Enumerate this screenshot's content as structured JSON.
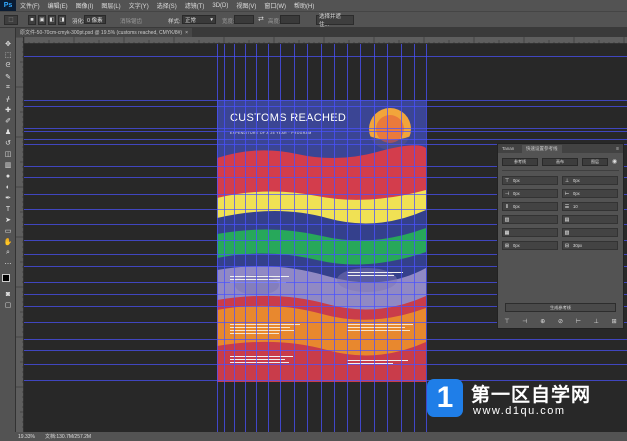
{
  "app": {
    "logo": "Ps"
  },
  "menu": [
    "文件(F)",
    "编辑(E)",
    "图像(I)",
    "图层(L)",
    "文字(Y)",
    "选择(S)",
    "滤镜(T)",
    "3D(D)",
    "视图(V)",
    "窗口(W)",
    "帮助(H)"
  ],
  "options": {
    "feather_label": "羽化:",
    "feather_value": "0 像素",
    "antialias_label": "消除锯齿",
    "style_label": "样式:",
    "style_value": "正常",
    "width_label": "宽度:",
    "height_label": "高度:",
    "select_mask_label": "选择并遮住..."
  },
  "document": {
    "tab_title": "原文件-50-70cm-cmyk-300pt.psd @ 19.5% (customs reached, CMYK/8#)",
    "close_glyph": "×"
  },
  "poster": {
    "title": "CUSTOMS REACHED",
    "subtitle": "EXPENDITURE OF A 25 YEAR  ·  PROGRAM"
  },
  "colors": {
    "band_navy": "#3b4594",
    "band_red": "#d33d4c",
    "band_yellow": "#f0e154",
    "band_green": "#27a85a",
    "band_lavender": "#9089c4",
    "band_orange": "#e8882e",
    "band_crimson": "#c93c4a",
    "sun": "#f2a53b",
    "guides": "#4a52ff"
  },
  "panel": {
    "tabs": [
      "Tanan",
      "快速设置参考线"
    ],
    "buttons": [
      "参考线",
      "画布",
      "图层"
    ],
    "rows_left": [
      "0px",
      "0px",
      "0px",
      "",
      "",
      "0px"
    ],
    "rows_right": [
      "0px",
      "0px",
      "10",
      "",
      "",
      "30px"
    ],
    "generate_label": "生成参考线"
  },
  "status": {
    "zoom": "19.33%",
    "doc_info": "文档:130.7M/257.2M"
  },
  "watermark": {
    "title": "第一区自学网",
    "url": "www.d1qu.com",
    "logo_char": "1"
  }
}
